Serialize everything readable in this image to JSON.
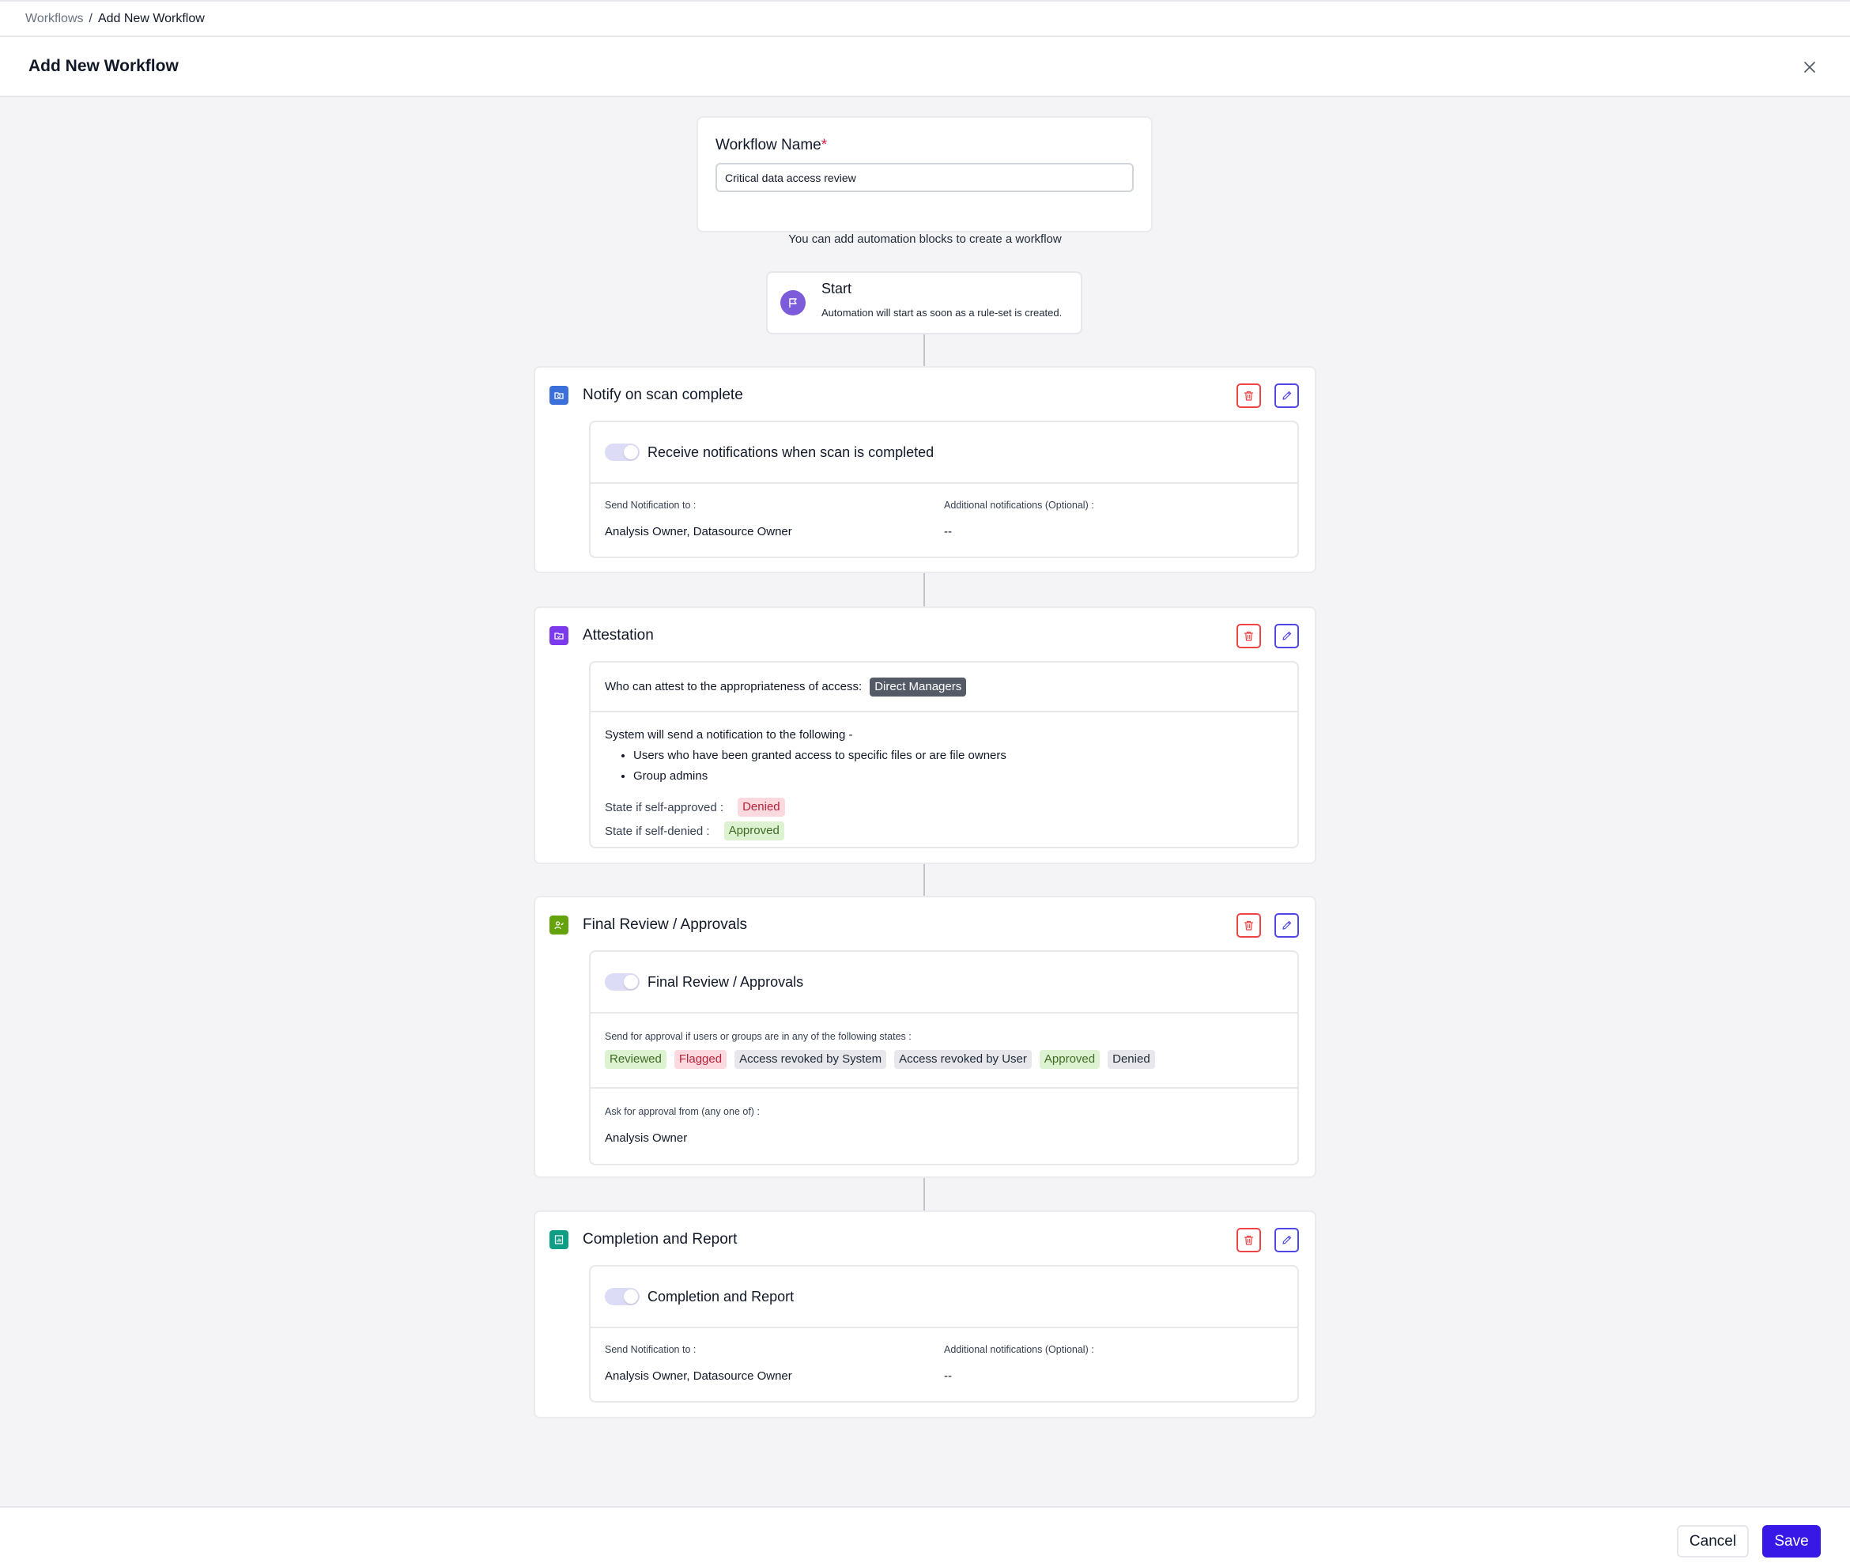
{
  "breadcrumb": {
    "parent": "Workflows",
    "separator": "/",
    "current": "Add New Workflow"
  },
  "header": {
    "title": "Add New Workflow"
  },
  "workflow_name": {
    "label": "Workflow Name",
    "required_mark": "*",
    "value": "Critical data access review"
  },
  "hint": "You can add automation blocks to create a workflow",
  "start": {
    "title": "Start",
    "subtitle": "Automation will start as soon as a rule-set is created."
  },
  "blocks": {
    "notify": {
      "title": "Notify on scan complete",
      "toggle_label": "Receive notifications when scan is completed",
      "send_label": "Send Notification to :",
      "send_value": "Analysis Owner, Datasource Owner",
      "additional_label": "Additional notifications (Optional) :",
      "additional_value": "--"
    },
    "attestation": {
      "title": "Attestation",
      "who_label": "Who can attest to the appropriateness of access:",
      "who_value": "Direct Managers",
      "system_text": "System will send a notification to the following -",
      "bullets": [
        "Users who have been granted access to specific files or are file owners",
        "Group admins"
      ],
      "self_approved_label": "State if self-approved :",
      "self_approved_value": "Denied",
      "self_denied_label": "State if self-denied :",
      "self_denied_value": "Approved"
    },
    "final_review": {
      "title": "Final Review / Approvals",
      "toggle_label": "Final Review / Approvals",
      "states_label": "Send for approval if users or groups are in any of the following states :",
      "states": [
        "Reviewed",
        "Flagged",
        "Access revoked by System",
        "Access revoked by User",
        "Approved",
        "Denied"
      ],
      "ask_label": "Ask for approval from (any one of) :",
      "ask_value": "Analysis Owner"
    },
    "completion": {
      "title": "Completion and Report",
      "toggle_label": "Completion and Report",
      "send_label": "Send Notification to :",
      "send_value": "Analysis Owner, Datasource Owner",
      "additional_label": "Additional notifications (Optional) :",
      "additional_value": "--"
    }
  },
  "colors": {
    "notify_icon": "#3b6fd9",
    "attestation_icon": "#7c3aed",
    "final_review_icon": "#65a30d",
    "completion_icon": "#0f9d85",
    "start_icon": "#7c5cdb",
    "save_button": "#3718e6"
  },
  "icons": {
    "close": "close-icon",
    "start": "flag-icon",
    "delete": "trash-icon",
    "edit": "pencil-icon"
  },
  "footer": {
    "cancel_label": "Cancel",
    "save_label": "Save"
  }
}
